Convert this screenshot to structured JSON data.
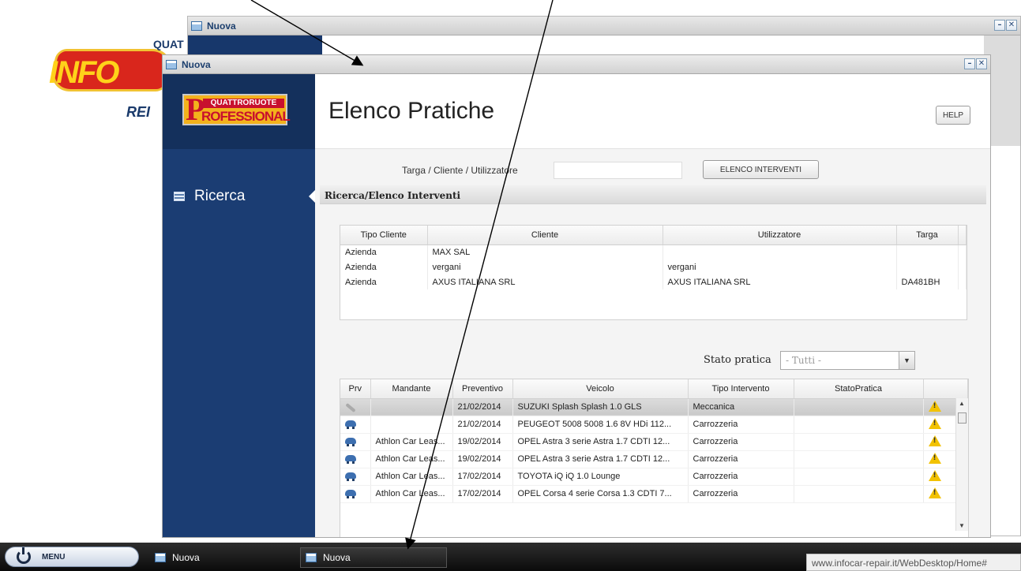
{
  "background_logo": {
    "top_text": "QUAT",
    "main_text": "INFO",
    "sub_text": "REI"
  },
  "back_window": {
    "title": "Nuova"
  },
  "front_window": {
    "title": "Nuova",
    "logo": {
      "letter": "P",
      "top": "QUATTRORUOTE",
      "bottom": "ROFESSIONAL"
    },
    "sidebar": {
      "items": [
        {
          "label": "Ricerca",
          "icon": "list-icon"
        }
      ]
    },
    "page_title": "Elenco Pratiche",
    "help_label": "HELP",
    "search": {
      "label": "Targa / Cliente / Utilizzatore",
      "value": "",
      "button_label": "ELENCO INTERVENTI"
    },
    "section_title": "Ricerca/Elenco Interventi",
    "clients_table": {
      "columns": [
        "Tipo Cliente",
        "Cliente",
        "Utilizzatore",
        "Targa"
      ],
      "rows": [
        [
          "Azienda",
          "MAX SAL",
          "",
          ""
        ],
        [
          "Azienda",
          "vergani",
          "vergani",
          ""
        ],
        [
          "Azienda",
          "AXUS ITALIANA SRL",
          "AXUS ITALIANA SRL",
          "DA481BH"
        ]
      ]
    },
    "stato": {
      "label": "Stato pratica",
      "selected": "- Tutti -"
    },
    "practices_table": {
      "columns": [
        "Prv",
        "Mandante",
        "Preventivo",
        "Veicolo",
        "Tipo Intervento",
        "StatoPratica"
      ],
      "rows": [
        {
          "icon": "wrench-icon",
          "mandante": "",
          "preventivo": "21/02/2014",
          "veicolo": "SUZUKI Splash Splash 1.0 GLS",
          "tipo": "Meccanica",
          "stato": ""
        },
        {
          "icon": "car-icon",
          "mandante": "",
          "preventivo": "21/02/2014",
          "veicolo": "PEUGEOT 5008 5008 1.6 8V HDi 112...",
          "tipo": "Carrozzeria",
          "stato": ""
        },
        {
          "icon": "car-icon",
          "mandante": "Athlon Car Leas...",
          "preventivo": "19/02/2014",
          "veicolo": "OPEL Astra 3 serie Astra 1.7 CDTI 12...",
          "tipo": "Carrozzeria",
          "stato": ""
        },
        {
          "icon": "car-icon",
          "mandante": "Athlon Car Leas...",
          "preventivo": "19/02/2014",
          "veicolo": "OPEL Astra 3 serie Astra 1.7 CDTI 12...",
          "tipo": "Carrozzeria",
          "stato": ""
        },
        {
          "icon": "car-icon",
          "mandante": "Athlon Car Leas...",
          "preventivo": "17/02/2014",
          "veicolo": "TOYOTA iQ iQ 1.0 Lounge",
          "tipo": "Carrozzeria",
          "stato": ""
        },
        {
          "icon": "car-icon",
          "mandante": "Athlon Car Leas...",
          "preventivo": "17/02/2014",
          "veicolo": "OPEL Corsa 4 serie Corsa 1.3 CDTI 7...",
          "tipo": "Carrozzeria",
          "stato": ""
        }
      ]
    }
  },
  "taskbar": {
    "start_label": "MENU",
    "items": [
      {
        "label": "Nuova"
      },
      {
        "label": "Nuova"
      }
    ],
    "status_url": "www.infocar-repair.it/WebDesktop/Home#"
  }
}
